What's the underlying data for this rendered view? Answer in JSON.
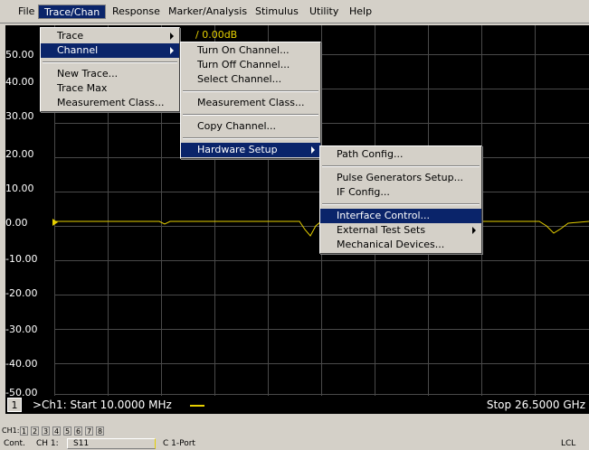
{
  "menubar": {
    "items": [
      "File",
      "Trace/Chan",
      "Response",
      "Marker/Analysis",
      "Stimulus",
      "Utility",
      "Help"
    ]
  },
  "menus": {
    "trace_chan": {
      "items": [
        "Trace",
        "Channel",
        "New Trace...",
        "Trace Max",
        "Measurement Class..."
      ]
    },
    "channel": {
      "items": [
        "Turn On Channel...",
        "Turn Off Channel...",
        "Select Channel...",
        "Measurement Class...",
        "Copy Channel...",
        "Hardware Setup"
      ]
    },
    "hardware_setup": {
      "items": [
        "Path Config...",
        "Pulse Generators Setup...",
        "IF Config...",
        "Interface Control...",
        "External Test Sets",
        "Mechanical Devices..."
      ]
    }
  },
  "plot": {
    "trace_title": "/ 0.00dB",
    "y_labels": [
      "50.00",
      "40.00",
      "30.00",
      "20.00",
      "10.00",
      "0.00",
      "-10.00",
      "-20.00",
      "-30.00",
      "-40.00",
      "-50.00"
    ],
    "channel_number": "1",
    "start_label": ">Ch1: Start  10.0000 MHz",
    "stop_label": "Stop  26.5000 GHz",
    "trace_color": "#e6d000"
  },
  "tabs": [
    "CH1:",
    "1",
    "2",
    "3",
    "4",
    "5",
    "6",
    "7",
    "8"
  ],
  "status": {
    "mode": "Cont.",
    "channel": "CH 1:",
    "param": "S11",
    "cal": "C  1-Port",
    "remote": "LCL"
  }
}
